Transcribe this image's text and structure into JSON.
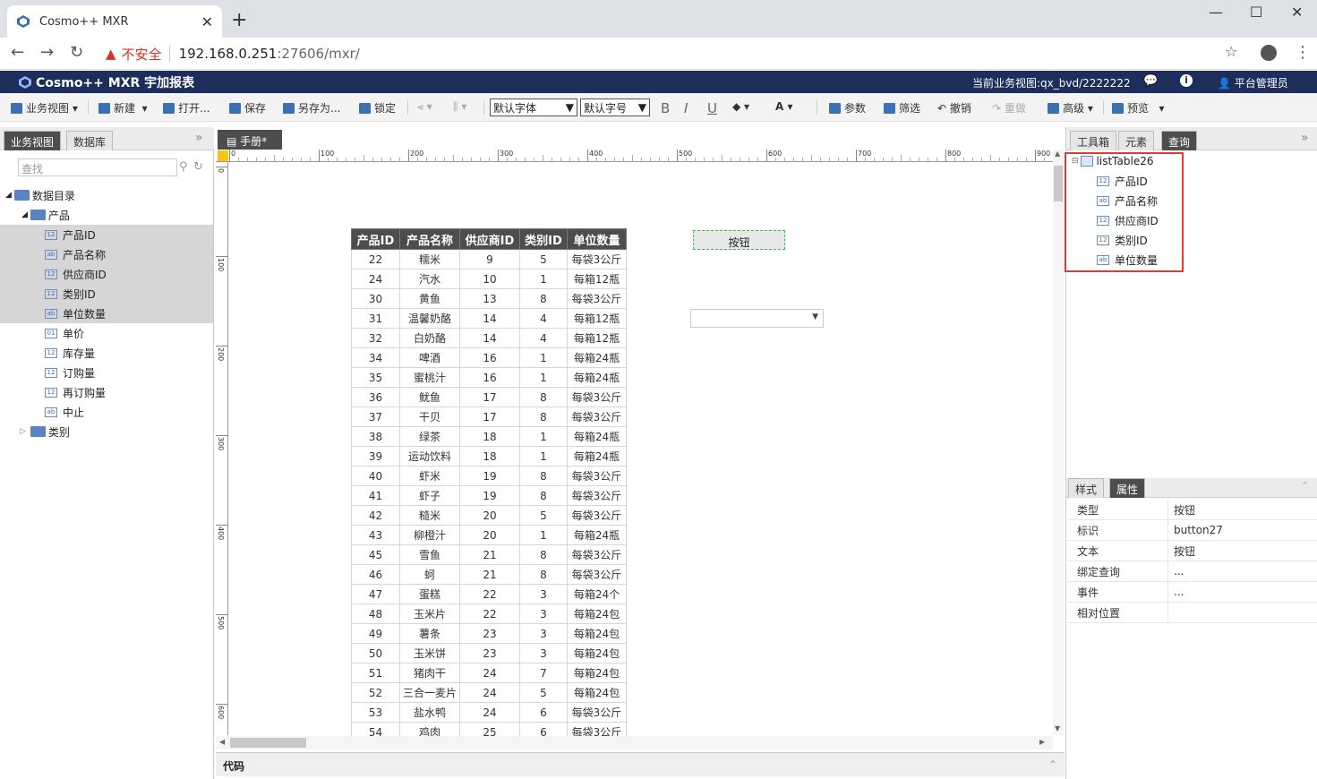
{
  "browser": {
    "tab_title": "Cosmo++ MXR",
    "security_label": "不安全",
    "url_host": "192.168.0.251",
    "url_rest": ":27606/mxr/"
  },
  "app": {
    "title": "Cosmo++ MXR 宇加报表",
    "current_view": "当前业务视图:qx_bvd/2222222",
    "user": "平台管理员"
  },
  "toolbar": {
    "business_view": "业务视图",
    "new": "新建",
    "open": "打开...",
    "save": "保存",
    "save_as": "另存为...",
    "lock": "锁定",
    "font_family": "默认字体",
    "font_size": "默认字号",
    "bold": "B",
    "italic": "I",
    "underline": "U",
    "params": "参数",
    "filter": "筛选",
    "undo": "撤销",
    "redo": "重做",
    "advanced": "高级",
    "preview": "预览"
  },
  "left_panel": {
    "tabs": [
      "业务视图",
      "数据库"
    ],
    "search_placeholder": "查找",
    "root": "数据目录",
    "folder": "产品",
    "fields": [
      {
        "type": "12",
        "label": "产品ID",
        "highlight": true
      },
      {
        "type": "ab",
        "label": "产品名称",
        "highlight": true
      },
      {
        "type": "12",
        "label": "供应商ID",
        "highlight": true
      },
      {
        "type": "12",
        "label": "类别ID",
        "highlight": true
      },
      {
        "type": "ab",
        "label": "单位数量",
        "highlight": true
      },
      {
        "type": "01",
        "label": "单价",
        "highlight": false
      },
      {
        "type": "12",
        "label": "库存量",
        "highlight": false
      },
      {
        "type": "12",
        "label": "订购量",
        "highlight": false
      },
      {
        "type": "12",
        "label": "再订购量",
        "highlight": false
      },
      {
        "type": "ab",
        "label": "中止",
        "highlight": false
      }
    ],
    "category_folder": "类别"
  },
  "editor": {
    "doc_tab": "手册*",
    "ruler_ticks": [
      "0",
      "100",
      "200",
      "300",
      "400",
      "500",
      "600",
      "700",
      "800",
      "900"
    ],
    "vruler_ticks": [
      "0",
      "100",
      "200",
      "300",
      "400",
      "500",
      "600"
    ],
    "button_text": "按钮",
    "code_label": "代码"
  },
  "table": {
    "headers": [
      "产品ID",
      "产品名称",
      "供应商ID",
      "类别ID",
      "单位数量"
    ],
    "rows": [
      [
        "22",
        "糯米",
        "9",
        "5",
        "每袋3公斤"
      ],
      [
        "24",
        "汽水",
        "10",
        "1",
        "每箱12瓶"
      ],
      [
        "30",
        "黄鱼",
        "13",
        "8",
        "每袋3公斤"
      ],
      [
        "31",
        "温馨奶酪",
        "14",
        "4",
        "每箱12瓶"
      ],
      [
        "32",
        "白奶酪",
        "14",
        "4",
        "每箱12瓶"
      ],
      [
        "34",
        "啤酒",
        "16",
        "1",
        "每箱24瓶"
      ],
      [
        "35",
        "蜜桃汁",
        "16",
        "1",
        "每箱24瓶"
      ],
      [
        "36",
        "鱿鱼",
        "17",
        "8",
        "每袋3公斤"
      ],
      [
        "37",
        "干贝",
        "17",
        "8",
        "每袋3公斤"
      ],
      [
        "38",
        "绿茶",
        "18",
        "1",
        "每箱24瓶"
      ],
      [
        "39",
        "运动饮料",
        "18",
        "1",
        "每箱24瓶"
      ],
      [
        "40",
        "虾米",
        "19",
        "8",
        "每袋3公斤"
      ],
      [
        "41",
        "虾子",
        "19",
        "8",
        "每袋3公斤"
      ],
      [
        "42",
        "糙米",
        "20",
        "5",
        "每袋3公斤"
      ],
      [
        "43",
        "柳橙汁",
        "20",
        "1",
        "每箱24瓶"
      ],
      [
        "45",
        "雪鱼",
        "21",
        "8",
        "每袋3公斤"
      ],
      [
        "46",
        "蚵",
        "21",
        "8",
        "每袋3公斤"
      ],
      [
        "47",
        "蛋糕",
        "22",
        "3",
        "每箱24个"
      ],
      [
        "48",
        "玉米片",
        "22",
        "3",
        "每箱24包"
      ],
      [
        "49",
        "薯条",
        "23",
        "3",
        "每箱24包"
      ],
      [
        "50",
        "玉米饼",
        "23",
        "3",
        "每箱24包"
      ],
      [
        "51",
        "猪肉干",
        "24",
        "7",
        "每箱24包"
      ],
      [
        "52",
        "三合一麦片",
        "24",
        "5",
        "每箱24包"
      ],
      [
        "53",
        "盐水鸭",
        "24",
        "6",
        "每袋3公斤"
      ],
      [
        "54",
        "鸡肉",
        "25",
        "6",
        "每袋3公斤"
      ]
    ]
  },
  "right_panel": {
    "tabs": [
      "工具箱",
      "元素",
      "查询"
    ],
    "query_name": "listTable26",
    "query_fields": [
      {
        "type": "12",
        "label": "产品ID"
      },
      {
        "type": "ab",
        "label": "产品名称"
      },
      {
        "type": "12",
        "label": "供应商ID"
      },
      {
        "type": "12",
        "label": "类别ID"
      },
      {
        "type": "ab",
        "label": "单位数量"
      }
    ],
    "prop_tabs": [
      "样式",
      "属性"
    ],
    "properties": [
      {
        "key": "类型",
        "value": "按钮"
      },
      {
        "key": "标识",
        "value": "button27"
      },
      {
        "key": "文本",
        "value": "按钮"
      },
      {
        "key": "绑定查询",
        "value": "..."
      },
      {
        "key": "事件",
        "value": "..."
      },
      {
        "key": "相对位置",
        "value": ""
      }
    ]
  },
  "colors": {
    "header_bg": "#1d2d5c",
    "highlight_box": "#e53935",
    "button_outline": "#2ecc40",
    "active_tab": "#4d4d4d"
  }
}
